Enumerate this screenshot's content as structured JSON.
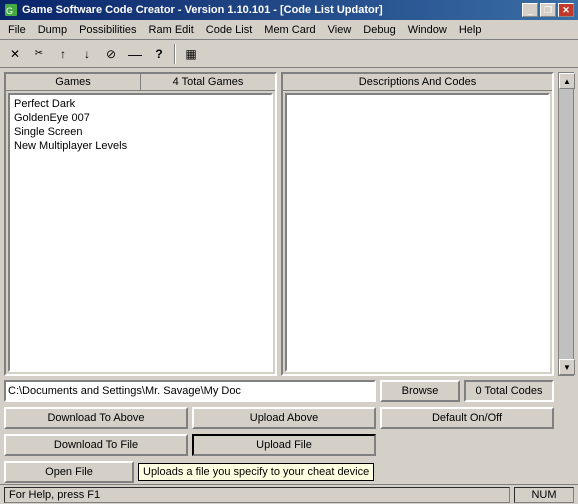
{
  "titlebar": {
    "title": "Game Software Code Creator - Version 1.10.101 - [Code List Updator]",
    "icon": "app-icon"
  },
  "menubar": {
    "items": [
      "File",
      "Dump",
      "Possibilities",
      "Ram Edit",
      "Code List",
      "Mem Card",
      "View",
      "Debug",
      "Window",
      "Help"
    ]
  },
  "toolbar": {
    "buttons": [
      {
        "icon": "✕",
        "name": "close-tool",
        "label": "X"
      },
      {
        "icon": "✂",
        "name": "cut-tool",
        "label": "cut"
      },
      {
        "icon": "↑",
        "name": "up-tool",
        "label": "↑"
      },
      {
        "icon": "↓",
        "name": "down-tool",
        "label": "↓"
      },
      {
        "icon": "⊘",
        "name": "cancel-tool",
        "label": "○"
      },
      {
        "icon": "—",
        "name": "dash-tool",
        "label": "—"
      },
      {
        "icon": "?",
        "name": "help-tool",
        "label": "?"
      },
      {
        "icon": "▦",
        "name": "grid-tool",
        "label": "▦"
      }
    ]
  },
  "left_panel": {
    "header": "Games",
    "games": [
      "Perfect Dark",
      "GoldenEye 007",
      "Single Screen",
      "New Multiplayer Levels"
    ]
  },
  "center_panel": {
    "header": "4 Total Games"
  },
  "right_panel": {
    "header": "Descriptions And Codes",
    "codes_label": "0 Total Codes"
  },
  "path_field": {
    "value": "C:\\Documents and Settings\\Mr. Savage\\My Doc",
    "placeholder": ""
  },
  "buttons": {
    "browse": "Browse",
    "download_above": "Download To Above",
    "upload_above": "Upload Above",
    "download_file": "Download To File",
    "upload_file": "Upload File",
    "open_file": "Open File",
    "default_onoff": "Default On/Off"
  },
  "tooltip": {
    "text": "Uploads a file you specify to your cheat device"
  },
  "statusbar": {
    "help_text": "For Help, press F1",
    "num_lock": "NUM"
  }
}
